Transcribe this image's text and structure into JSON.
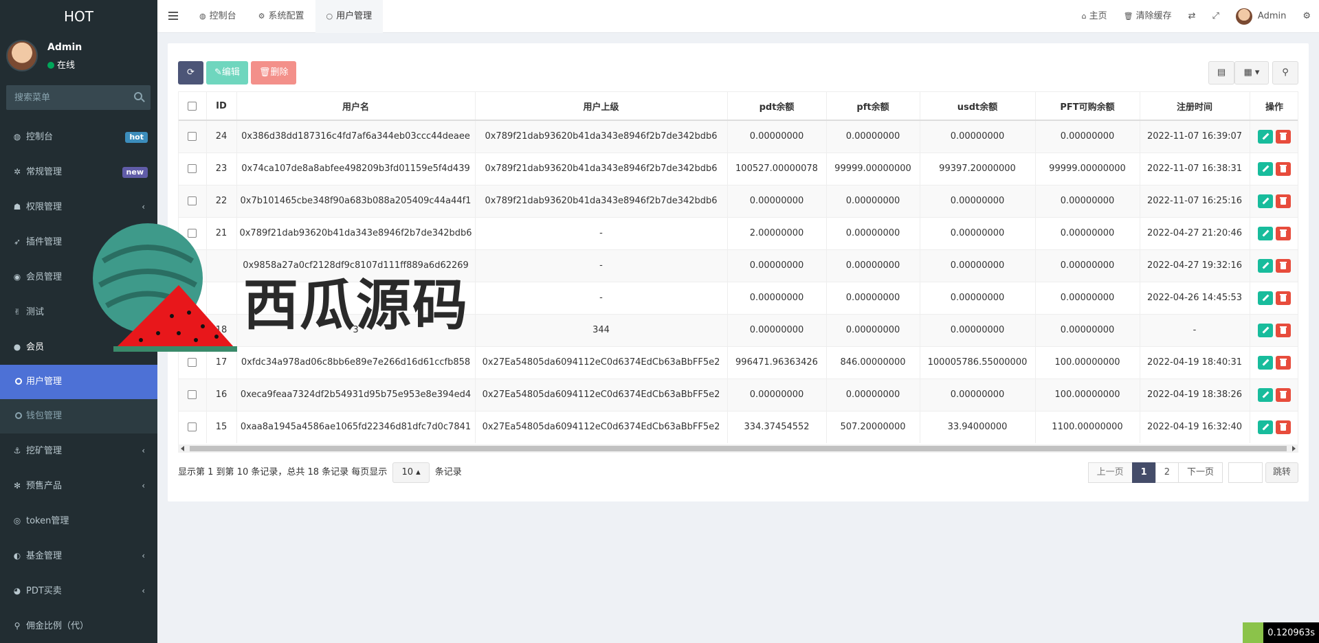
{
  "sidebar": {
    "logo": "HOT",
    "user": {
      "name": "Admin",
      "status": "在线"
    },
    "search_placeholder": "搜索菜单",
    "items": [
      {
        "label": "控制台",
        "icon": "dashboard-icon",
        "badge": "hot"
      },
      {
        "label": "常规管理",
        "icon": "cogs-icon",
        "badge": "new"
      },
      {
        "label": "权限管理",
        "icon": "group-icon"
      },
      {
        "label": "插件管理",
        "icon": "rocket-icon"
      },
      {
        "label": "会员管理",
        "icon": "user-circle-icon"
      },
      {
        "label": "测试",
        "icon": "hand-icon"
      },
      {
        "label": "会员",
        "icon": "user-icon"
      },
      {
        "label": "挖矿管理",
        "icon": "anchor-icon"
      },
      {
        "label": "预售产品",
        "icon": "yelp-icon"
      },
      {
        "label": "token管理",
        "icon": "ring-icon"
      },
      {
        "label": "基金管理",
        "icon": "adjust-icon"
      },
      {
        "label": "PDT买卖",
        "icon": "compass-icon"
      },
      {
        "label": "佣金比例（代）",
        "icon": "tree-icon"
      }
    ],
    "sub_items": [
      {
        "label": "用户管理"
      },
      {
        "label": "钱包管理"
      }
    ]
  },
  "topnav": {
    "tabs": [
      {
        "label": "控制台"
      },
      {
        "label": "系统配置"
      },
      {
        "label": "用户管理"
      }
    ],
    "home": "主页",
    "clear_cache": "清除缓存",
    "admin": "Admin"
  },
  "toolbar": {
    "edit": "编辑",
    "delete": "删除"
  },
  "table": {
    "headers": [
      "ID",
      "用户名",
      "用户上级",
      "pdt余额",
      "pft余额",
      "usdt余额",
      "PFT可购余额",
      "注册时间",
      "操作"
    ],
    "rows": [
      [
        "24",
        "0x386d38dd187316c4fd7af6a344eb03ccc44deaee",
        "0x789f21dab93620b41da343e8946f2b7de342bdb6",
        "0.00000000",
        "0.00000000",
        "0.00000000",
        "0.00000000",
        "2022-11-07 16:39:07"
      ],
      [
        "23",
        "0x74ca107de8a8abfee498209b3fd01159e5f4d439",
        "0x789f21dab93620b41da343e8946f2b7de342bdb6",
        "100527.00000078",
        "99999.00000000",
        "99397.20000000",
        "99999.00000000",
        "2022-11-07 16:38:31"
      ],
      [
        "22",
        "0x7b101465cbe348f90a683b088a205409c44a44f1",
        "0x789f21dab93620b41da343e8946f2b7de342bdb6",
        "0.00000000",
        "0.00000000",
        "0.00000000",
        "0.00000000",
        "2022-11-07 16:25:16"
      ],
      [
        "21",
        "0x789f21dab93620b41da343e8946f2b7de342bdb6",
        "-",
        "2.00000000",
        "0.00000000",
        "0.00000000",
        "0.00000000",
        "2022-04-27 21:20:46"
      ],
      [
        "",
        "0x9858a27a0cf2128df9c8107d111ff889a6d62269",
        "-",
        "0.00000000",
        "0.00000000",
        "0.00000000",
        "0.00000000",
        "2022-04-27 19:32:16"
      ],
      [
        "",
        "",
        "-",
        "0.00000000",
        "0.00000000",
        "0.00000000",
        "0.00000000",
        "2022-04-26 14:45:53"
      ],
      [
        "18",
        "3",
        "344",
        "0.00000000",
        "0.00000000",
        "0.00000000",
        "0.00000000",
        "-"
      ],
      [
        "17",
        "0xfdc34a978ad06c8bb6e89e7e266d16d61ccfb858",
        "0x27Ea54805da6094112eC0d6374EdCb63aBbFF5e2",
        "996471.96363426",
        "846.00000000",
        "100005786.55000000",
        "100.00000000",
        "2022-04-19 18:40:31"
      ],
      [
        "16",
        "0xeca9feaa7324df2b54931d95b75e953e8e394ed4",
        "0x27Ea54805da6094112eC0d6374EdCb63aBbFF5e2",
        "0.00000000",
        "0.00000000",
        "0.00000000",
        "100.00000000",
        "2022-04-19 18:38:26"
      ],
      [
        "15",
        "0xaa8a1945a4586ae1065fd22346d81dfc7d0c7841",
        "0x27Ea54805da6094112eC0d6374EdCb63aBbFF5e2",
        "334.37454552",
        "507.20000000",
        "33.94000000",
        "1100.00000000",
        "2022-04-19 16:32:40"
      ]
    ]
  },
  "pager": {
    "info_prefix": "显示第 1 到第 10 条记录，总共 18 条记录 每页显示",
    "page_size": "10",
    "info_suffix": "条记录",
    "prev": "上一页",
    "pages": [
      "1",
      "2"
    ],
    "next": "下一页",
    "jump": "跳转"
  },
  "watermark": {
    "text": "西瓜源码"
  },
  "timer": "0.120963s",
  "colors": {
    "sidebar_bg": "#222d32",
    "active_sub": "#4d71d6",
    "edit_btn": "#18bc9c",
    "delete_btn": "#e74c3c",
    "page_active": "#444c69"
  }
}
